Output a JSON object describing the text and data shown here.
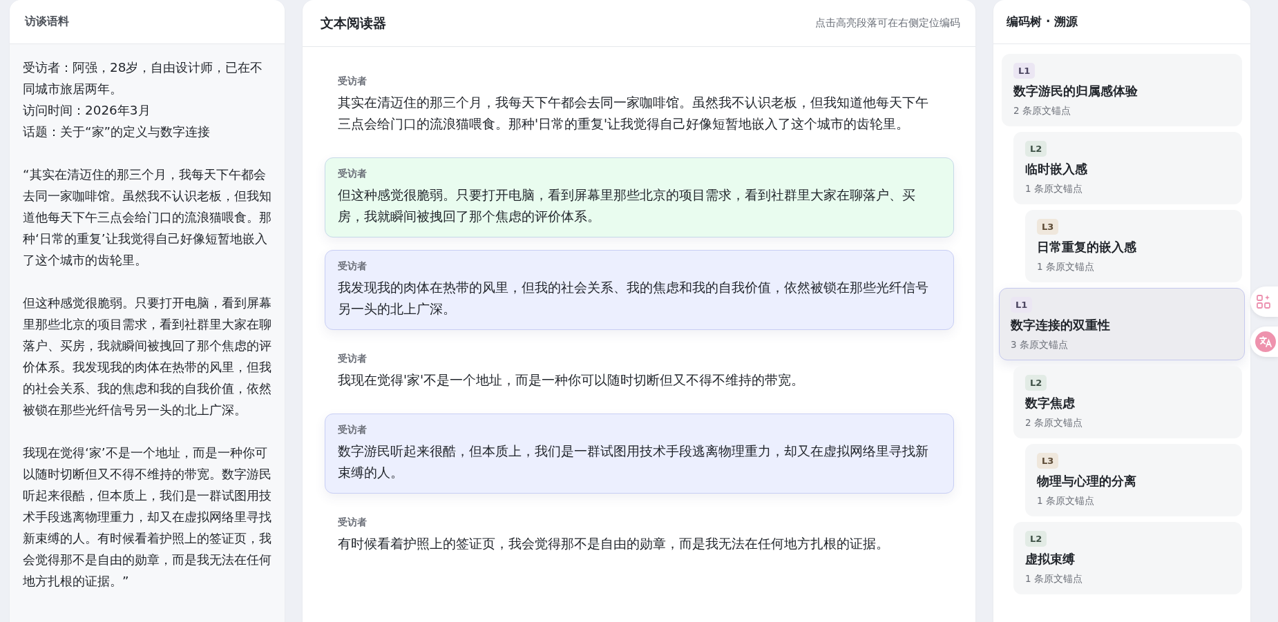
{
  "interview_panel": {
    "title": "访谈语料",
    "meta_lines": [
      "受访者：阿强，28岁，自由设计师，已在不同城市旅居两年。",
      "访问时间：2026年3月",
      "话题：关于“家”的定义与数字连接"
    ],
    "paragraphs": [
      "“其实在清迈住的那三个月，我每天下午都会去同一家咖啡馆。虽然我不认识老板，但我知道他每天下午三点会给门口的流浪猫喂食。那种‘日常的重复’让我觉得自己好像短暂地嵌入了这个城市的齿轮里。",
      "但这种感觉很脆弱。只要打开电脑，看到屏幕里那些北京的项目需求，看到社群里大家在聊落户、买房，我就瞬间被拽回了那个焦虑的评价体系。我发现我的肉体在热带的风里，但我的社会关系、我的焦虑和我的自我价值，依然被锁在那些光纤信号另一头的北上广深。",
      "我现在觉得‘家’不是一个地址，而是一种你可以随时切断但又不得不维持的带宽。数字游民听起来很酷，但本质上，我们是一群试图用技术手段逃离物理重力，却又在虚拟网络里寻找新束缚的人。有时候看着护照上的签证页，我会觉得那不是自由的勋章，而是我无法在任何地方扎根的证据。”"
    ]
  },
  "reader": {
    "title": "文本阅读器",
    "hint": "点击高亮段落可在右侧定位编码",
    "segments": [
      {
        "speaker": "受访者",
        "text": "其实在清迈住的那三个月，我每天下午都会去同一家咖啡馆。虽然我不认识老板，但我知道他每天下午三点会给门口的流浪猫喂食。那种'日常的重复'让我觉得自己好像短暂地嵌入了这个城市的齿轮里。"
      },
      {
        "speaker": "受访者",
        "text": "但这种感觉很脆弱。只要打开电脑，看到屏幕里那些北京的项目需求，看到社群里大家在聊落户、买房，我就瞬间被拽回了那个焦虑的评价体系。",
        "color": "#e9fcef"
      },
      {
        "speaker": "受访者",
        "text": "我发现我的肉体在热带的风里，但我的社会关系、我的焦虑和我的自我价值，依然被锁在那些光纤信号另一头的北上广深。",
        "color": "#eceffe"
      },
      {
        "speaker": "受访者",
        "text": "我现在觉得'家'不是一个地址，而是一种你可以随时切断但又不得不维持的带宽。"
      },
      {
        "speaker": "受访者",
        "text": "数字游民听起来很酷，但本质上，我们是一群试图用技术手段逃离物理重力，却又在虚拟网络里寻找新束缚的人。",
        "color": "#eceffe"
      },
      {
        "speaker": "受访者",
        "text": "有时候看着护照上的签证页，我会觉得那不是自由的勋章，而是我无法在任何地方扎根的证据。"
      }
    ]
  },
  "code_tree": {
    "title": "编码树 · 溯源",
    "nodes": [
      {
        "level": "L1",
        "name": "数字游民的归属感体验",
        "anchors": "2 条原文锚点",
        "selected": false,
        "children": [
          {
            "level": "L2",
            "name": "临时嵌入感",
            "anchors": "1 条原文锚点",
            "selected": false,
            "children": [
              {
                "level": "L3",
                "name": "日常重复的嵌入感",
                "anchors": "1 条原文锚点",
                "selected": false
              }
            ]
          }
        ]
      },
      {
        "level": "L1",
        "name": "数字连接的双重性",
        "anchors": "3 条原文锚点",
        "selected": true,
        "children": [
          {
            "level": "L2",
            "name": "数字焦虑",
            "anchors": "2 条原文锚点",
            "selected": false,
            "children": [
              {
                "level": "L3",
                "name": "物理与心理的分离",
                "anchors": "1 条原文锚点",
                "selected": false
              }
            ]
          },
          {
            "level": "L2",
            "name": "虚拟束缚",
            "anchors": "1 条原文锚点",
            "selected": false
          }
        ]
      }
    ]
  }
}
